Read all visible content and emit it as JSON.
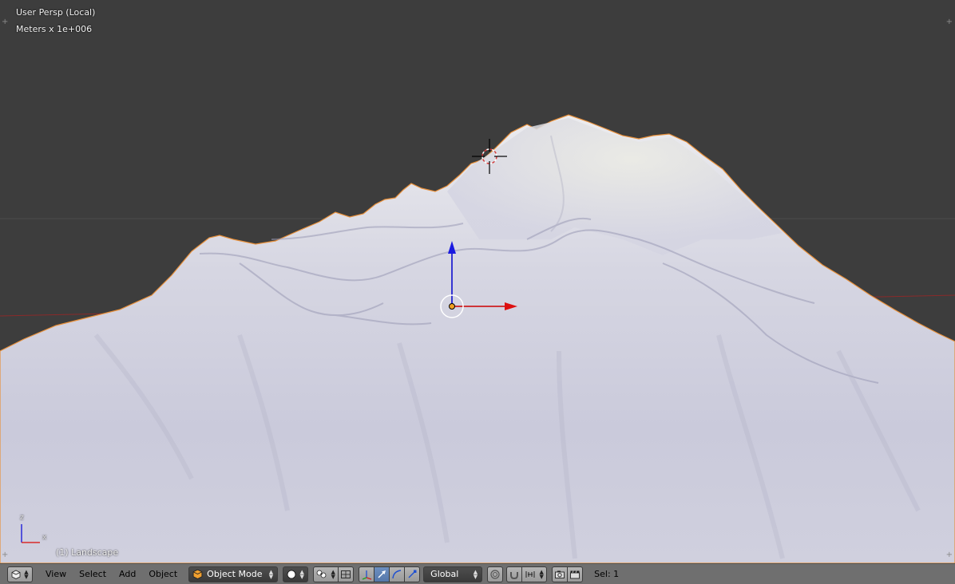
{
  "viewport": {
    "view_name": "User Persp (Local)",
    "units": "Meters x 1e+006",
    "object_label": "(1) Landscape",
    "axis_z": "z",
    "axis_x": "x"
  },
  "header": {
    "menu": {
      "view": "View",
      "select": "Select",
      "add": "Add",
      "object": "Object"
    },
    "mode": "Object Mode",
    "orientation": "Global",
    "selection": "Sel: 1"
  },
  "icons": {
    "editor_type": "cube-icon",
    "mode": "object-cube-icon",
    "shading": "solid-sphere-icon",
    "pivot": "pivot-point-icon",
    "manipulator": "manipulator-icon",
    "translate": "translate-arrow-icon",
    "rotate": "rotate-arc-icon",
    "scale": "scale-icon",
    "proportional": "proportional-editing-icon",
    "snap": "magnet-icon",
    "snap_element": "snap-element-icon",
    "render_opengl": "camera-icon",
    "render_anim": "clapperboard-icon"
  },
  "colors": {
    "background": "#3d3d3d",
    "header": "#6f6f6f",
    "axis_x": "#cc0000",
    "axis_z": "#0000cc",
    "selection_outline": "#e8903a"
  }
}
